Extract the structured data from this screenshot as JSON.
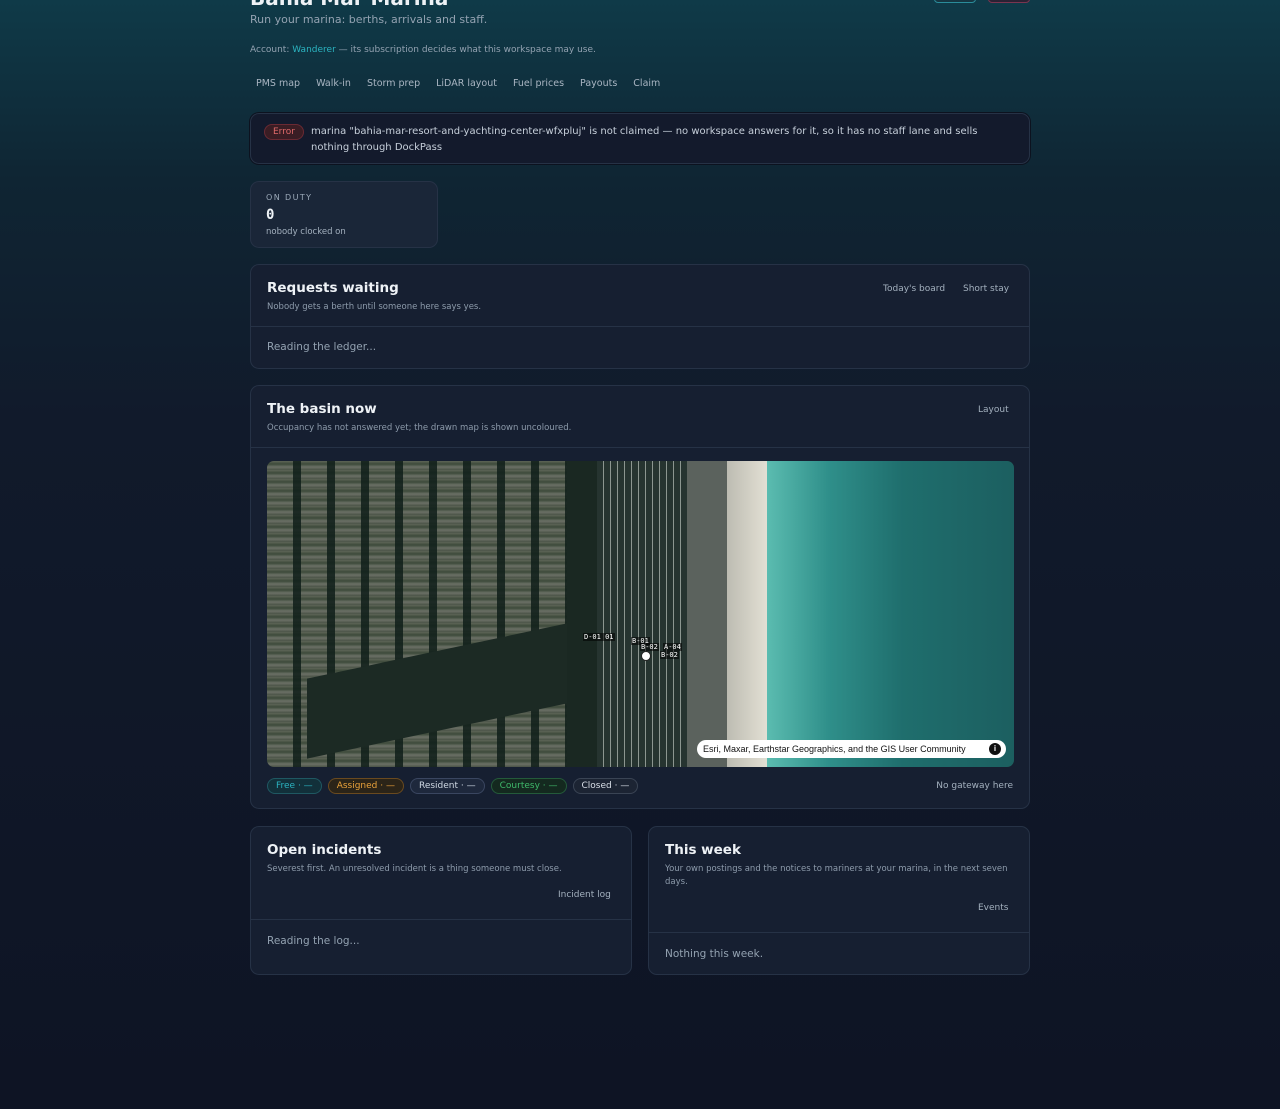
{
  "header": {
    "title": "Bahia Mar Marina",
    "subtitle": "Run your marina: berths, arrivals and staff.",
    "account_prefix": "Account: ",
    "account_name": "Wanderer",
    "account_suffix": " — its subscription decides what this workspace may use."
  },
  "tabs": [
    "PMS map",
    "Walk-in",
    "Storm prep",
    "LiDAR layout",
    "Fuel prices",
    "Payouts",
    "Claim"
  ],
  "error": {
    "badge": "Error",
    "message": "marina \"bahia-mar-resort-and-yachting-center-wfxpluj\" is not claimed — no workspace answers for it, so it has no staff lane and sells nothing through DockPass"
  },
  "on_duty": {
    "label": "ON DUTY",
    "value": "0",
    "note": "nobody clocked on"
  },
  "requests": {
    "title": "Requests waiting",
    "subtitle": "Nobody gets a berth until someone here says yes.",
    "link1": "Today's board",
    "link2": "Short stay",
    "body": "Reading the ledger..."
  },
  "basin": {
    "title": "The basin now",
    "subtitle": "Occupancy has not answered yet; the drawn map is shown uncoloured.",
    "link": "Layout",
    "berths": [
      "D-01 01",
      "B-01",
      "B-02",
      "A-04",
      "B-02"
    ],
    "attribution": "Esri, Maxar, Earthstar Geographics, and the GIS User Community",
    "info_icon": "i",
    "legend": {
      "free": "Free · —",
      "assigned": "Assigned · —",
      "resident": "Resident · —",
      "courtesy": "Courtesy · —",
      "closed": "Closed · —"
    },
    "gateway": "No gateway here"
  },
  "incidents": {
    "title": "Open incidents",
    "subtitle": "Severest first. An unresolved incident is a thing someone must close.",
    "link": "Incident log",
    "body": "Reading the log..."
  },
  "week": {
    "title": "This week",
    "subtitle": "Your own postings and the notices to mariners at your marina, in the next seven days.",
    "link": "Events",
    "body": "Nothing this week."
  }
}
